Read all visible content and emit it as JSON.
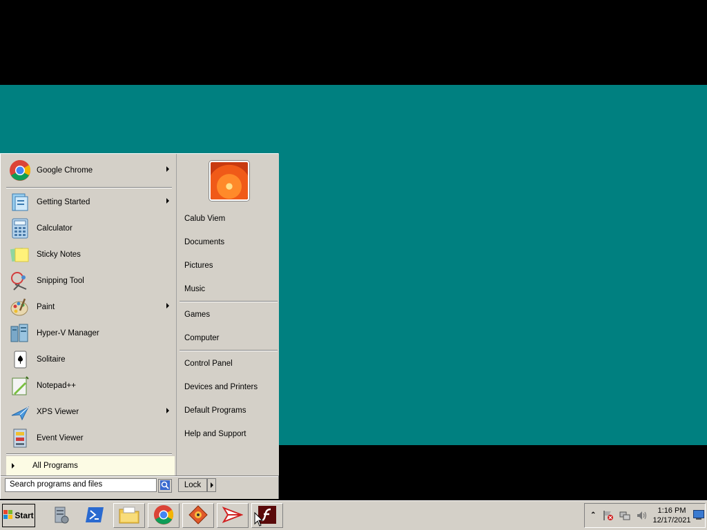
{
  "start_menu": {
    "pinned": [
      {
        "label": "Google Chrome",
        "icon": "chrome-icon",
        "has_submenu": true
      }
    ],
    "recent": [
      {
        "label": "Getting Started",
        "icon": "getting-started-icon",
        "has_submenu": true
      },
      {
        "label": "Calculator",
        "icon": "calculator-icon",
        "has_submenu": false
      },
      {
        "label": "Sticky Notes",
        "icon": "sticky-notes-icon",
        "has_submenu": false
      },
      {
        "label": "Snipping Tool",
        "icon": "snipping-tool-icon",
        "has_submenu": false
      },
      {
        "label": "Paint",
        "icon": "paint-icon",
        "has_submenu": true
      },
      {
        "label": "Hyper-V Manager",
        "icon": "hyperv-manager-icon",
        "has_submenu": false
      },
      {
        "label": "Solitaire",
        "icon": "solitaire-icon",
        "has_submenu": false
      },
      {
        "label": "Notepad++",
        "icon": "notepadpp-icon",
        "has_submenu": false
      },
      {
        "label": "XPS Viewer",
        "icon": "xps-viewer-icon",
        "has_submenu": true
      },
      {
        "label": "Event Viewer",
        "icon": "event-viewer-icon",
        "has_submenu": false
      }
    ],
    "all_programs": "All Programs",
    "search_placeholder": "Search programs and files",
    "lock_label": "Lock",
    "right_items_group1": [
      "Calub Viem",
      "Documents",
      "Pictures",
      "Music"
    ],
    "right_items_group2": [
      "Games",
      "Computer"
    ],
    "right_items_group3": [
      "Control Panel",
      "Devices and Printers",
      "Default Programs",
      "Help and Support"
    ]
  },
  "taskbar": {
    "start_label": "Start",
    "buttons": [
      "server-manager-icon",
      "powershell-icon",
      "file-explorer-icon",
      "chrome-icon",
      "app-icon",
      "sender-icon",
      "flash-icon"
    ],
    "clock_time": "1:16 PM",
    "clock_date": "12/17/2021"
  },
  "colors": {
    "desktop": "#008080",
    "menu": "#d4d0c8",
    "all_programs_bg": "#fcfbe4"
  }
}
